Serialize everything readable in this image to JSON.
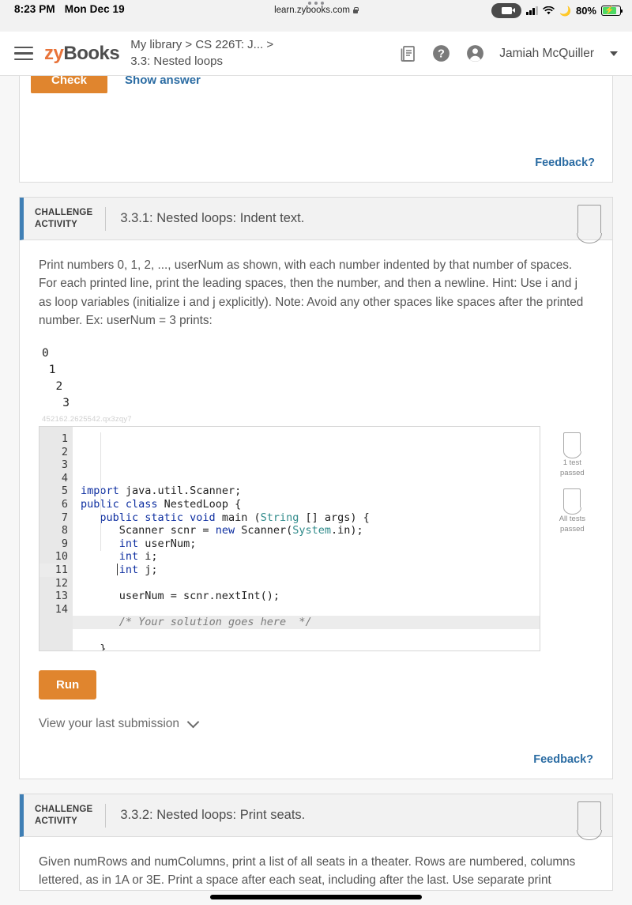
{
  "status_bar": {
    "time": "8:23 PM",
    "date": "Mon Dec 19",
    "url": "learn.zybooks.com",
    "battery_percent": "80%",
    "battery_level": 80,
    "charging": true,
    "icons": [
      "camera-recording-indicator",
      "cellular-signal-icon",
      "wifi-icon",
      "do-not-disturb-moon-icon",
      "battery-charging-icon",
      "lock-icon",
      "tab-overflow-dots"
    ]
  },
  "header": {
    "logo_zy": "zy",
    "logo_books": "Books",
    "breadcrumb_line1": "My library > CS 226T: J...  >",
    "breadcrumb_line2": "3.3: Nested loops",
    "username": "Jamiah McQuiller",
    "icons": [
      "hamburger-menu-icon",
      "library-book-icon",
      "help-circle-icon",
      "user-avatar-icon",
      "chevron-down-icon"
    ]
  },
  "top_card": {
    "check_label": "Check",
    "show_answer_label": "Show answer",
    "feedback_label": "Feedback?"
  },
  "activity_1": {
    "tag_line1": "CHALLENGE",
    "tag_line2": "ACTIVITY",
    "title": "3.3.1: Nested loops: Indent text.",
    "prompt": "Print numbers 0, 1, 2, ..., userNum as shown, with each number indented by that number of spaces. For each printed line, print the leading spaces, then the number, and then a newline. Hint: Use i and j as loop variables (initialize i and j explicitly). Note: Avoid any other spaces like spaces after the printed number. Ex: userNum = 3 prints:",
    "example_output": "0\n 1\n  2\n   3",
    "watermark": "452162.2625542.qx3zqy7",
    "code_lines": [
      {
        "n": "1",
        "html": "<span class=\"kw\">import</span> java.util.Scanner;"
      },
      {
        "n": "2",
        "html": "<span class=\"kw\">public class</span> NestedLoop {"
      },
      {
        "n": "3",
        "html": "   <span class=\"kw\">public static void</span> main (<span class=\"cls\">String</span> [] args) {"
      },
      {
        "n": "4",
        "html": "      Scanner scnr = <span class=\"kw\">new</span> Scanner(<span class=\"cls\">System</span>.in);"
      },
      {
        "n": "5",
        "html": "      <span class=\"kw\">int</span> userNum;"
      },
      {
        "n": "6",
        "html": "      <span class=\"kw\">int</span> i;"
      },
      {
        "n": "7",
        "html": "      <span class=\"kw\">int</span> j;"
      },
      {
        "n": "8",
        "html": ""
      },
      {
        "n": "9",
        "html": "      userNum = scnr.nextInt();"
      },
      {
        "n": "10",
        "html": ""
      },
      {
        "n": "11",
        "html": "      <span class=\"cmt\">/* Your solution goes here  */</span>",
        "highlighted": true
      },
      {
        "n": "12",
        "html": ""
      },
      {
        "n": "13",
        "html": "   }"
      },
      {
        "n": "14",
        "html": "}"
      }
    ],
    "badges": [
      {
        "label": "1 test\npassed",
        "icon": "shield-badge-icon"
      },
      {
        "label": "All tests\npassed",
        "icon": "shield-badge-icon"
      }
    ],
    "run_label": "Run",
    "submission_label": "View your last submission",
    "feedback_label": "Feedback?"
  },
  "activity_2": {
    "tag_line1": "CHALLENGE",
    "tag_line2": "ACTIVITY",
    "title": "3.3.2: Nested loops: Print seats.",
    "prompt": "Given numRows and numColumns, print a list of all seats in a theater. Rows are numbered, columns lettered, as in 1A or 3E. Print a space after each seat, including after the last. Use separate print"
  },
  "colors": {
    "accent_orange": "#e0852e",
    "link_blue": "#2b6ca3",
    "activity_bar_blue": "#3f7fb5",
    "logo_orange": "#e8743b",
    "battery_green": "#4cd964"
  }
}
